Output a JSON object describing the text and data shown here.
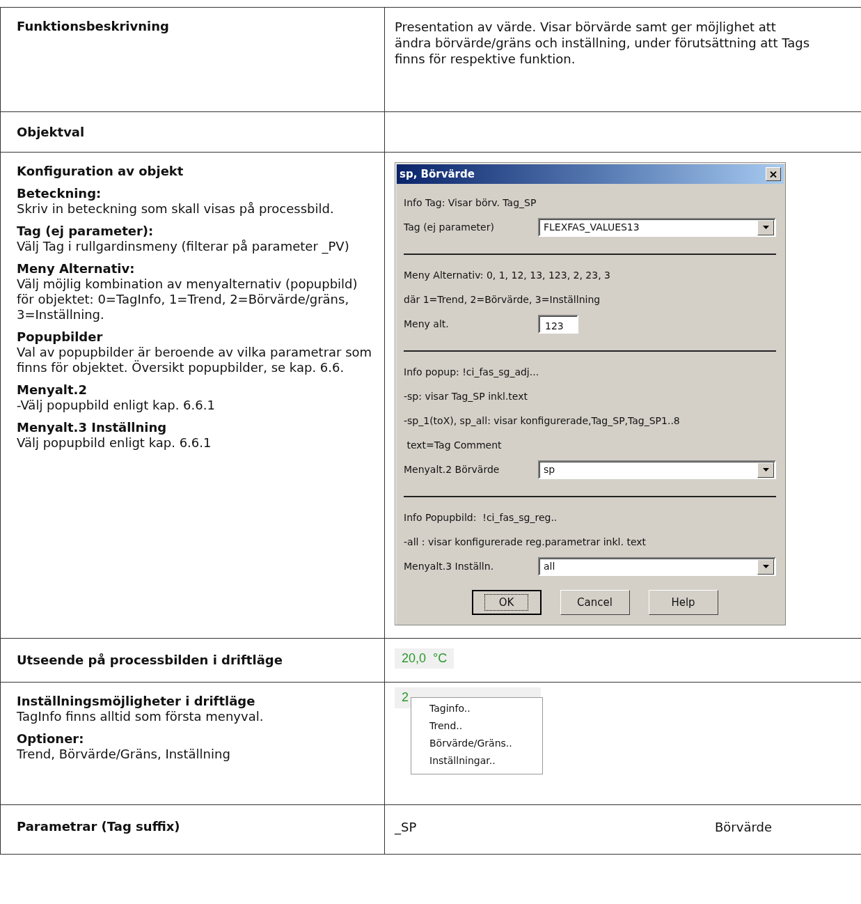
{
  "rows": [
    {
      "kind": "text",
      "heading": "Funktionsbeskrivning",
      "text": "Presentation av värde.  Visar börvärde samt ger möjlighet att ändra börvärde/gräns och inställning, under förutsättning att Tags finns för respektive funktion."
    },
    {
      "kind": "empty",
      "heading": "Objektval"
    },
    {
      "kind": "dialog",
      "heading": "Konfiguration av objekt",
      "sections": [
        {
          "title": "Beteckning:",
          "text": "Skriv in beteckning som skall visas på processbild."
        },
        {
          "title": "Tag (ej parameter):",
          "text": "Välj Tag i rullgardinsmeny (filterar på parameter _PV)"
        },
        {
          "title": "Meny Alternativ:",
          "text": "Välj möjlig kombination av menyalternativ (popupbild) för objektet: 0=TagInfo, 1=Trend, 2=Börvärde/gräns, 3=Inställning."
        },
        {
          "title": "Popupbilder",
          "text": "Val av popupbilder är beroende av vilka parametrar som finns för objektet. Översikt popupbilder, se kap. 6.6."
        },
        {
          "title": "Menyalt.2",
          "text": "-Välj popupbild enligt kap. 6.6.1"
        },
        {
          "title": "Menyalt.3 Inställning",
          "text": "Välj popupbild enligt kap. 6.6.1"
        }
      ],
      "dialog": {
        "title": "sp, Börvärde",
        "items": [
          {
            "kind": "info",
            "text": "Info Tag: Visar börv. Tag_SP"
          },
          {
            "kind": "combo",
            "label": "Tag (ej parameter)",
            "value": "FLEXFAS_VALUES13"
          },
          {
            "kind": "separator"
          },
          {
            "kind": "info",
            "text": "Meny Alternativ: 0, 1, 12, 13, 123, 2, 23, 3"
          },
          {
            "kind": "info",
            "text": "där 1=Trend, 2=Börvärde, 3=Inställning"
          },
          {
            "kind": "field",
            "label": "Meny alt.",
            "value": "123"
          },
          {
            "kind": "separator"
          },
          {
            "kind": "info",
            "text": "Info popup: !ci_fas_sg_adj..."
          },
          {
            "kind": "info",
            "text": "-sp: visar Tag_SP inkl.text"
          },
          {
            "kind": "info",
            "text": "-sp_1(toX), sp_all: visar konfigurerade,Tag_SP,Tag_SP1..8"
          },
          {
            "kind": "info",
            "text": " text=Tag Comment"
          },
          {
            "kind": "combo",
            "label": "Menyalt.2 Börvärde",
            "value": "sp"
          },
          {
            "kind": "separator"
          },
          {
            "kind": "info",
            "text": "Info Popupbild:  !ci_fas_sg_reg.."
          },
          {
            "kind": "info",
            "text": "-all : visar konfigurerade reg.parametrar inkl. text"
          },
          {
            "kind": "combo",
            "label": "Menyalt.3 Inställn.",
            "value": "all"
          }
        ],
        "buttons": [
          {
            "label": "OK",
            "default": true
          },
          {
            "label": "Cancel",
            "default": false
          },
          {
            "label": "Help",
            "default": false
          }
        ]
      }
    },
    {
      "kind": "value",
      "heading": "Utseende på processbilden i driftläge",
      "value": "20,0  °C"
    },
    {
      "kind": "menu",
      "heading": "Inställningsmöjligheter i driftläge",
      "subtext": "TagInfo finns alltid som första menyval.",
      "sections": [
        {
          "title": "Optioner:",
          "text": "Trend, Börvärde/Gräns, Inställning"
        }
      ],
      "value": "2",
      "menu": [
        "Taginfo..",
        "Trend..",
        "Börvärde/Gräns..",
        "Inställningar.."
      ]
    },
    {
      "kind": "params",
      "heading": "Parametrar (Tag suffix)",
      "param": "_SP",
      "description": "Börvärde"
    }
  ]
}
